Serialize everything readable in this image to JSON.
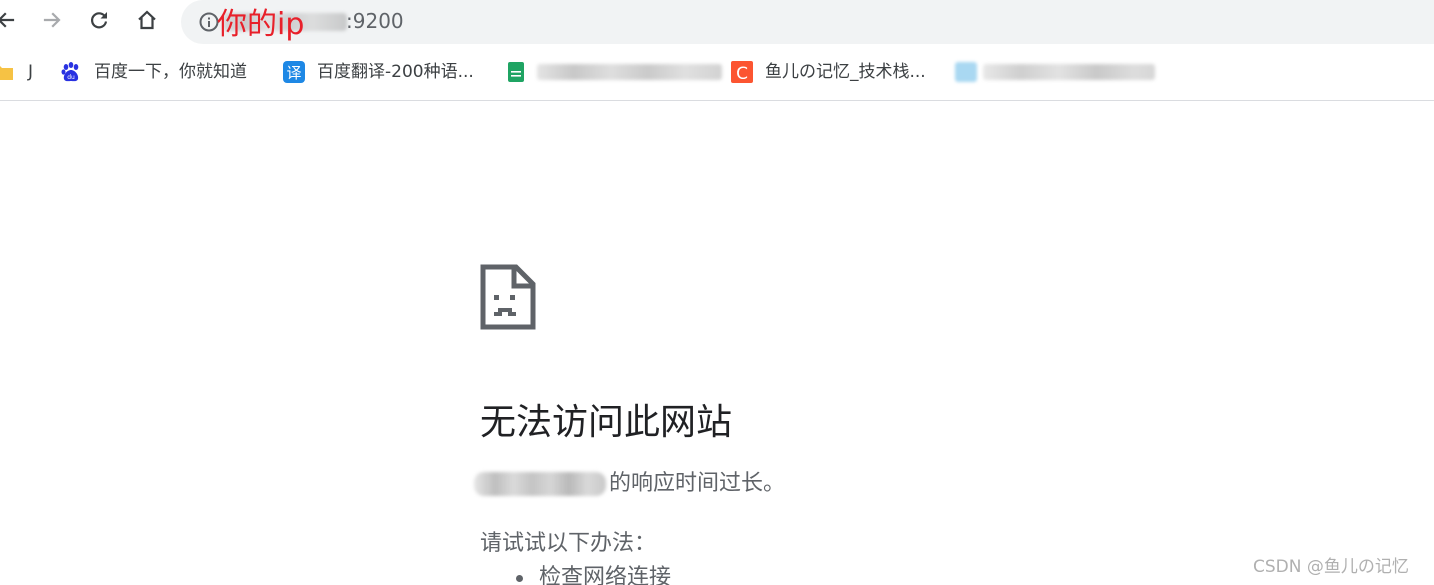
{
  "toolbar": {
    "back_icon": "arrow-left-icon",
    "forward_icon": "arrow-right-icon",
    "reload_icon": "reload-icon",
    "home_icon": "home-icon"
  },
  "omnibox": {
    "info_icon": "info-icon",
    "url_suffix": ":9200",
    "annotation": "你的ip"
  },
  "bookmarks": [
    {
      "label": "J",
      "icon": "folder-icon"
    },
    {
      "label": "百度一下，你就知道",
      "icon": "baidu-paw-icon"
    },
    {
      "label": "百度翻译-200种语...",
      "icon": "translate-icon"
    },
    {
      "label": "",
      "icon": "green-sheet-icon"
    },
    {
      "label": "鱼儿の记忆_技术栈...",
      "icon": "csdn-c-icon"
    },
    {
      "label": "",
      "icon": "blurred-site-icon"
    }
  ],
  "error": {
    "icon": "sad-page-icon",
    "title": "无法访问此网站",
    "description": "的响应时间过长。",
    "suggestions_heading": "请试试以下办法：",
    "suggestions": [
      "检查网络连接"
    ]
  },
  "watermark": "CSDN @鱼儿の记忆",
  "colors": {
    "annotation": "#e8202a",
    "omnibox_bg": "#f1f3f4",
    "baidu_blue": "#2932e1",
    "translate_blue": "#1e88e5",
    "sheet_green": "#1fa463",
    "csdn_red": "#fc5531",
    "text_primary": "#202124",
    "text_secondary": "#5f6368"
  }
}
